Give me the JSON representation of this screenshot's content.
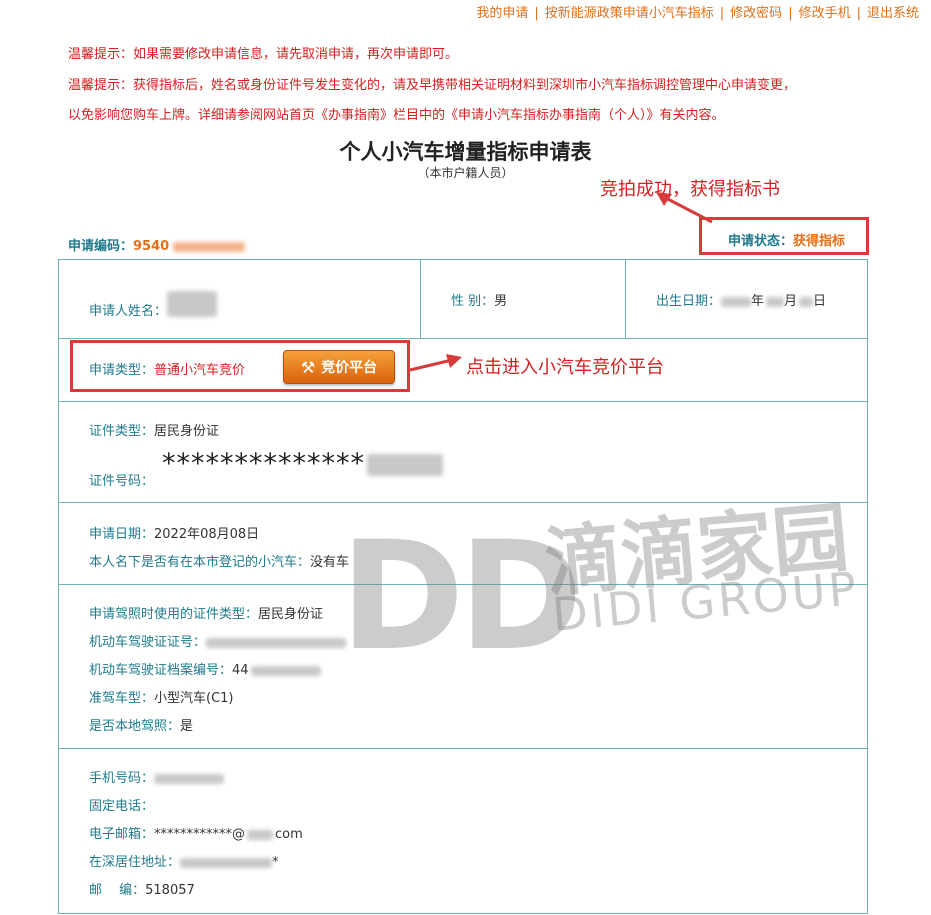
{
  "nav": {
    "items": [
      "我的申请",
      "按新能源政策申请小汽车指标",
      "修改密码",
      "修改手机",
      "退出系统"
    ],
    "separator": "|"
  },
  "tips": [
    "温馨提示：如果需要修改申请信息，请先取消申请，再次申请即可。",
    "温馨提示：获得指标后，姓名或身份证件号发生变化的，请及早携带相关证明材料到深圳市小汽车指标调控管理中心申请变更，",
    "以免影响您购车上牌。详细请参阅网站首页《办事指南》栏目中的《申请小汽车指标办事指南（个人）》有关内容。"
  ],
  "form_title": "个人小汽车增量指标申请表",
  "form_subtitle": "（本市户籍人员）",
  "annotations": {
    "status": "竞拍成功，获得指标书",
    "platform": "点击进入小汽车竞价平台"
  },
  "application_no": {
    "label": "申请编码：",
    "value": "9540"
  },
  "status": {
    "label": "申请状态：",
    "value": "获得指标"
  },
  "applicant": {
    "name_label": "申请人姓名：",
    "gender_label": "性 别：",
    "gender": "男",
    "birth_label": "出生日期：",
    "birth_year_unit": "年",
    "birth_month_unit": "月",
    "birth_day_unit": "日"
  },
  "application_type": {
    "label": "申请类型：",
    "value": "普通小汽车竞价",
    "button": "竞价平台"
  },
  "certificate": {
    "type_label": "证件类型：",
    "type": "居民身份证",
    "number_label": "证件号码：",
    "number_masked": "**************"
  },
  "application_info": {
    "date_label": "申请日期：",
    "date": "2022年08月08日",
    "car_label": "本人名下是否有在本市登记的小汽车：",
    "car": "没有车"
  },
  "license": {
    "cert_type_label": "申请驾照时使用的证件类型：",
    "cert_type": "居民身份证",
    "license_no_label": "机动车驾驶证证号：",
    "file_no_label": "机动车驾驶证档案编号：",
    "file_no_prefix": "44",
    "class_label": "准驾车型：",
    "class": "小型汽车(C1)",
    "local_label": "是否本地驾照：",
    "local": "是"
  },
  "contact": {
    "phone_label": "手机号码：",
    "tel_label": "固定电话：",
    "email_label": "电子邮箱：",
    "email_masked": "************@",
    "email_suffix": "com",
    "address_label": "在深居住地址：",
    "address_suffix": "*",
    "postcode_label": "邮　 编：",
    "postcode": "518057"
  },
  "watermark": {
    "logo": "DD",
    "cn": "滴滴家园",
    "en": "DIDI GROUP"
  },
  "colors": {
    "accent_orange": "#e0701a",
    "tip_red": "#d42020",
    "teal": "#1f7a8c",
    "annot_red": "#d93b3b"
  }
}
